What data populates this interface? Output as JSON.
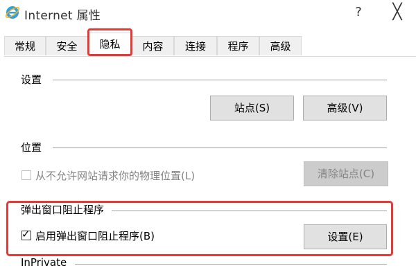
{
  "window": {
    "title": "Internet 属性",
    "help_label": "?",
    "close_label": "╳"
  },
  "tabs": [
    {
      "label": "常规"
    },
    {
      "label": "安全"
    },
    {
      "label": "隐私",
      "active": true
    },
    {
      "label": "内容"
    },
    {
      "label": "连接"
    },
    {
      "label": "程序"
    },
    {
      "label": "高级"
    }
  ],
  "settings": {
    "title": "设置",
    "sites_button": "站点(S)",
    "advanced_button": "高级(V)"
  },
  "location": {
    "title": "位置",
    "checkbox_label": "从不允许网站请求你的物理位置(L)",
    "checkbox_checked": false,
    "clear_sites_button": "清除站点(C)"
  },
  "popup_blocker": {
    "title": "弹出窗口阻止程序",
    "checkbox_label": "启用弹出窗口阻止程序(B)",
    "checkbox_checked": true,
    "settings_button": "设置(E)"
  },
  "inprivate": {
    "title": "InPrivate"
  },
  "colors": {
    "highlight": "#e53935",
    "button_bg": "#e1e1e1",
    "disabled_text": "#838383"
  }
}
